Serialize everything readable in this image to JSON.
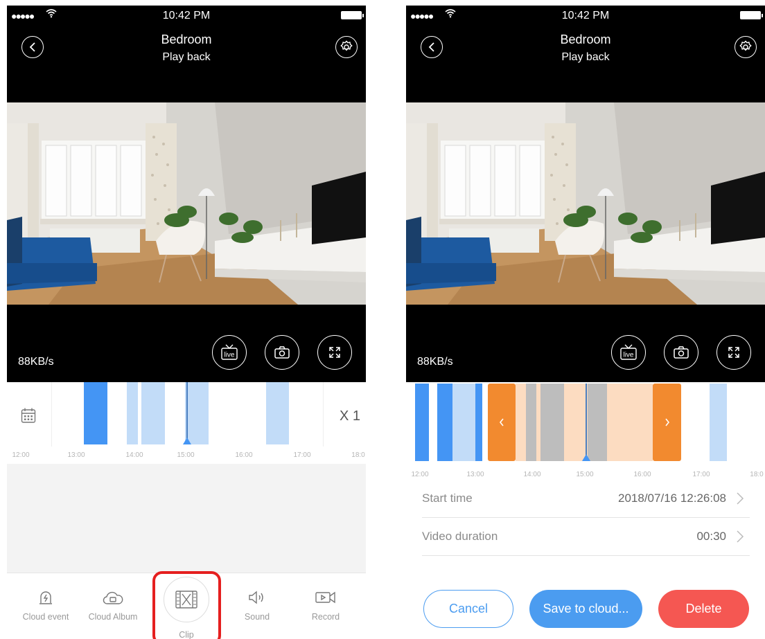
{
  "status": {
    "time": "10:42 PM",
    "signal": "●●●●●",
    "wifi": "wifi-icon"
  },
  "header": {
    "title": "Bedroom",
    "subtitle": "Play back"
  },
  "player": {
    "speed": "88KB/s",
    "live_label": "live"
  },
  "timeline": {
    "ticks": [
      "12:00",
      "13:00",
      "14:00",
      "15:00",
      "16:00",
      "17:00",
      "18:0"
    ],
    "zoom": "X 1"
  },
  "bottom_nav": {
    "items": [
      {
        "label": "Cloud event",
        "icon": "cloud-event-icon"
      },
      {
        "label": "Cloud Album",
        "icon": "cloud-album-icon"
      },
      {
        "label": "Clip",
        "icon": "clip-icon"
      },
      {
        "label": "Sound",
        "icon": "sound-icon"
      },
      {
        "label": "Record",
        "icon": "record-icon"
      }
    ]
  },
  "clip_panel": {
    "start_label": "Start time",
    "start_value": "2018/07/16 12:26:08",
    "duration_label": "Video duration",
    "duration_value": "00:30",
    "cancel": "Cancel",
    "save": "Save to cloud...",
    "delete": "Delete"
  },
  "colors": {
    "accent": "#4b9cf0",
    "segment_dark": "#4495f4",
    "segment_light": "#c2dcf8",
    "clip_handle": "#f28a2f",
    "clip_range": "#fcdcc1",
    "delete": "#f55752",
    "highlight": "#e51f1f"
  }
}
